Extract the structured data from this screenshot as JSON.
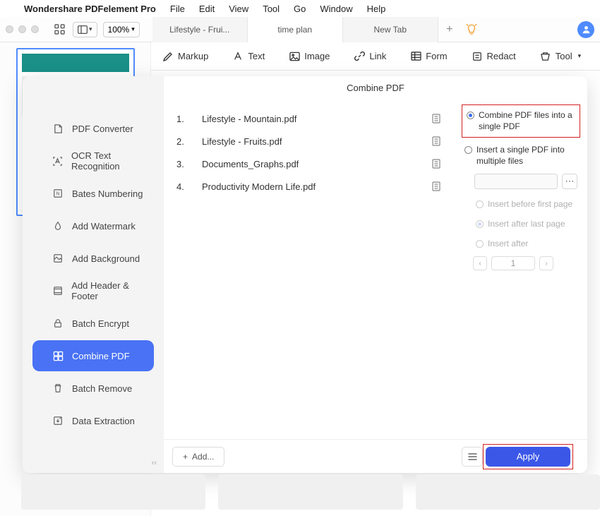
{
  "menu": {
    "app_name": "Wondershare PDFelement Pro",
    "items": [
      "File",
      "Edit",
      "View",
      "Tool",
      "Go",
      "Window",
      "Help"
    ]
  },
  "toolbar": {
    "zoom": "100%",
    "tabs": [
      "Lifestyle - Frui...",
      "time plan",
      "New Tab"
    ]
  },
  "ribbon": {
    "markup": "Markup",
    "text": "Text",
    "image": "Image",
    "link": "Link",
    "form": "Form",
    "redact": "Redact",
    "tool": "Tool"
  },
  "modal": {
    "title": "Combine PDF",
    "sidebar": [
      "PDF Converter",
      "OCR Text Recognition",
      "Bates Numbering",
      "Add Watermark",
      "Add Background",
      "Add Header & Footer",
      "Batch Encrypt",
      "Combine PDF",
      "Batch Remove",
      "Data Extraction"
    ],
    "files": [
      {
        "n": "1.",
        "name": "Lifestyle - Mountain.pdf"
      },
      {
        "n": "2.",
        "name": "Lifestyle - Fruits.pdf"
      },
      {
        "n": "3.",
        "name": "Documents_Graphs.pdf"
      },
      {
        "n": "4.",
        "name": "Productivity Modern Life.pdf"
      }
    ],
    "options": {
      "combine_label": "Combine PDF files into a single PDF",
      "insert_label": "Insert a single PDF into multiple files",
      "before_label": "Insert before first page",
      "after_last_label": "Insert after last page",
      "after_label": "Insert after",
      "page_value": "1"
    },
    "add_label": "Add...",
    "apply_label": "Apply"
  }
}
